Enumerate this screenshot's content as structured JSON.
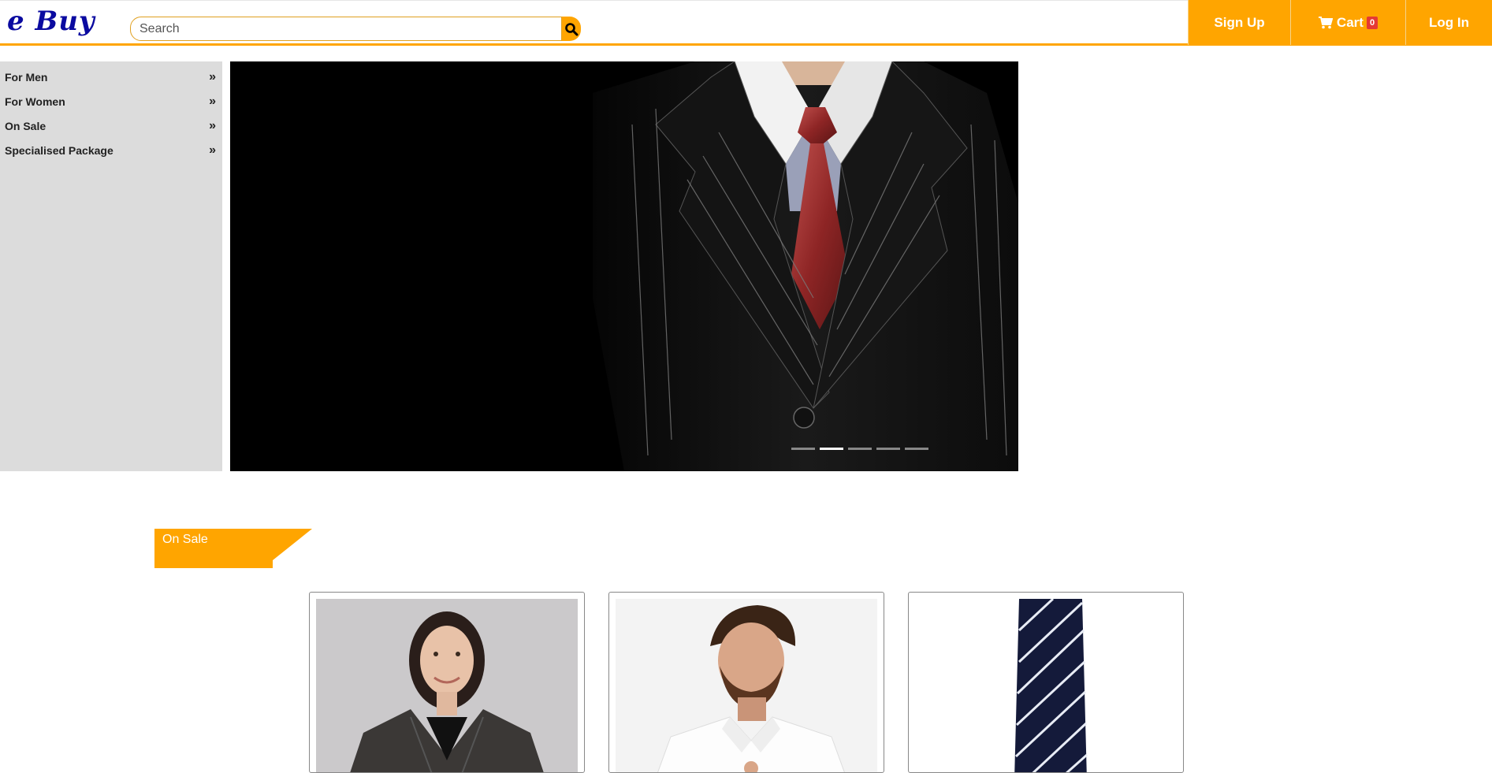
{
  "header": {
    "logo": "e Buy",
    "search_placeholder": "Search",
    "nav": {
      "signup": "Sign Up",
      "cart": "Cart",
      "cart_count": "0",
      "login": "Log In"
    }
  },
  "sidebar": {
    "items": [
      {
        "label": "For Men"
      },
      {
        "label": "For Women"
      },
      {
        "label": "On Sale"
      },
      {
        "label": "Specialised Package"
      }
    ]
  },
  "carousel": {
    "slide_count": 5,
    "active_index": 1,
    "image": "suit-red-tie"
  },
  "sections": {
    "on_sale": {
      "title": "On Sale",
      "products": [
        {
          "image": "woman-blazer"
        },
        {
          "image": "man-white-shirt"
        },
        {
          "image": "striped-navy-tie"
        }
      ]
    }
  },
  "colors": {
    "accent": "#ffa500",
    "logo": "#0a0aa0",
    "badge": "#e53935",
    "sidebar_bg": "#dcdcdc"
  }
}
